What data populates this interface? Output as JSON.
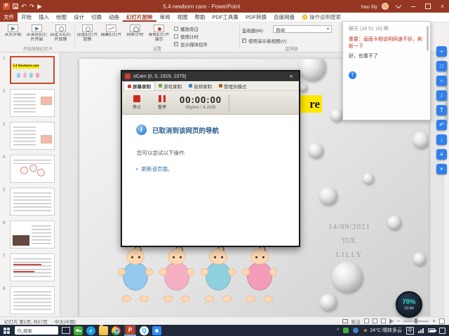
{
  "window": {
    "title": "5.4 newborn care - PowerPoint",
    "user": "hao lily"
  },
  "icons": {
    "undo": "↶",
    "redo": "↷",
    "play": "▶",
    "caret": "▾",
    "close": "×",
    "chevron_up": "^",
    "sun": "☀",
    "bullet": "•",
    "check": "✓",
    "info": "i"
  },
  "ribbon": {
    "tabs": [
      "文件",
      "开始",
      "插入",
      "绘图",
      "设计",
      "切换",
      "动画",
      "幻灯片放映",
      "审阅",
      "视图",
      "帮助",
      "PDF工具集",
      "PDF转换",
      "百度网盘"
    ],
    "active_tab": "幻灯片放映",
    "search_label": "操作说明搜索",
    "groups": {
      "g1": {
        "label": "开始放映幻灯片",
        "buttons": [
          "从头开始",
          "从当前幻灯片开始",
          "自定义幻灯片放映"
        ]
      },
      "g2": {
        "label": "设置",
        "buttons": [
          "设置幻灯片放映",
          "隐藏幻灯片",
          "排练计时",
          "录制幻灯片演示"
        ],
        "checks": [
          {
            "label": "播放旁白",
            "checked": false
          },
          {
            "label": "使用计时",
            "checked": false
          },
          {
            "label": "显示媒体控件",
            "checked": true
          }
        ]
      },
      "g3": {
        "label": "监视器",
        "monitor_label": "监视器(M):",
        "monitor_value": "自动",
        "presenter_label": "使用演示者视图(V)",
        "presenter_checked": true
      }
    }
  },
  "thumbnails": [
    {
      "num": "1",
      "title": "5.4 Newborn care"
    },
    {
      "num": "2"
    },
    {
      "num": "3"
    },
    {
      "num": "4"
    },
    {
      "num": "5"
    },
    {
      "num": "6"
    },
    {
      "num": "7"
    },
    {
      "num": "8"
    }
  ],
  "slide": {
    "title_fragment": "re",
    "date": "14/09/2021",
    "day": "TUE.",
    "name": "LILLY"
  },
  "ocam": {
    "title": "oCam [0, 0, 1919, 1079]",
    "tabs": [
      "屏幕录制",
      "游戏录制",
      "音频录制",
      "管理员模式"
    ],
    "stop_label": "停止",
    "pause_label": "暂停",
    "time": "00:00:00",
    "size": "0bytes / 4.2GB",
    "error": {
      "heading": "已取消到该网页的导航",
      "hint": "您可以尝试以下操作:",
      "link": "刷新该页面。"
    }
  },
  "chat": {
    "lines": [
      "聊天 (18 51 10)  啊",
      "重要：画面卡顿说明网速不好，刷新一下",
      "好，也看不了"
    ],
    "tool": "T"
  },
  "sidebar_tools": [
    "+",
    "□",
    "○",
    "/",
    "T",
    "↶",
    "↓",
    "≡",
    "×"
  ],
  "widget": {
    "percent": "70%",
    "time": "10:46"
  },
  "status": {
    "slide_info": "幻灯片 第1页, 共57页",
    "language": "中文(中国)",
    "comments": "批注"
  },
  "taskbar": {
    "search": "搜索",
    "weather": "24°C 晴转多云",
    "ime": "中",
    "app_letters": {
      "ppt": "P",
      "edge": "e",
      "qq": "Q"
    }
  }
}
